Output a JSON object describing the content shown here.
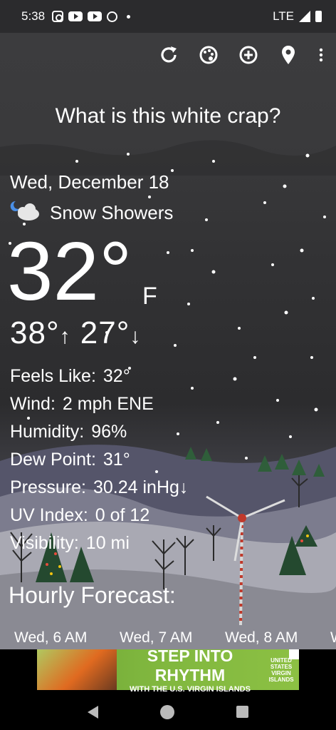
{
  "status_bar": {
    "time": "5:38",
    "network": "LTE"
  },
  "toolbar": {
    "icons": [
      "refresh-icon",
      "themes-icon",
      "add-location-icon",
      "location-pin-icon",
      "overflow-menu-icon"
    ]
  },
  "headline": "What is this white crap?",
  "current": {
    "date": "Wed, December 18",
    "condition": "Snow Showers",
    "temperature": "32°",
    "unit": "F",
    "high": "38°",
    "low": "27°"
  },
  "details": [
    {
      "label": "Feels Like:",
      "value": "32°"
    },
    {
      "label": "Wind:",
      "value": "2 mph ENE"
    },
    {
      "label": "Humidity:",
      "value": "96%"
    },
    {
      "label": "Dew Point:",
      "value": "31°"
    },
    {
      "label": "Pressure:",
      "value": "30.24 inHg↓"
    },
    {
      "label": "UV Index:",
      "value": "0 of 12"
    },
    {
      "label": "Visibility:",
      "value": "10 mi"
    }
  ],
  "hourly": {
    "title": "Hourly Forecast:",
    "items": [
      "Wed, 6 AM",
      "Wed, 7 AM",
      "Wed, 8 AM",
      "W"
    ]
  },
  "ad": {
    "headline": "STEP INTO RHYTHM",
    "subline": "WITH THE U.S. VIRGIN ISLANDS",
    "logo_line1": "UNITED",
    "logo_line2": "STATES",
    "logo_line3": "VIRGIN",
    "logo_line4": "ISLANDS"
  },
  "colors": {
    "sky_top": "#3c3c3e",
    "ad_green": "#7fb63e"
  }
}
